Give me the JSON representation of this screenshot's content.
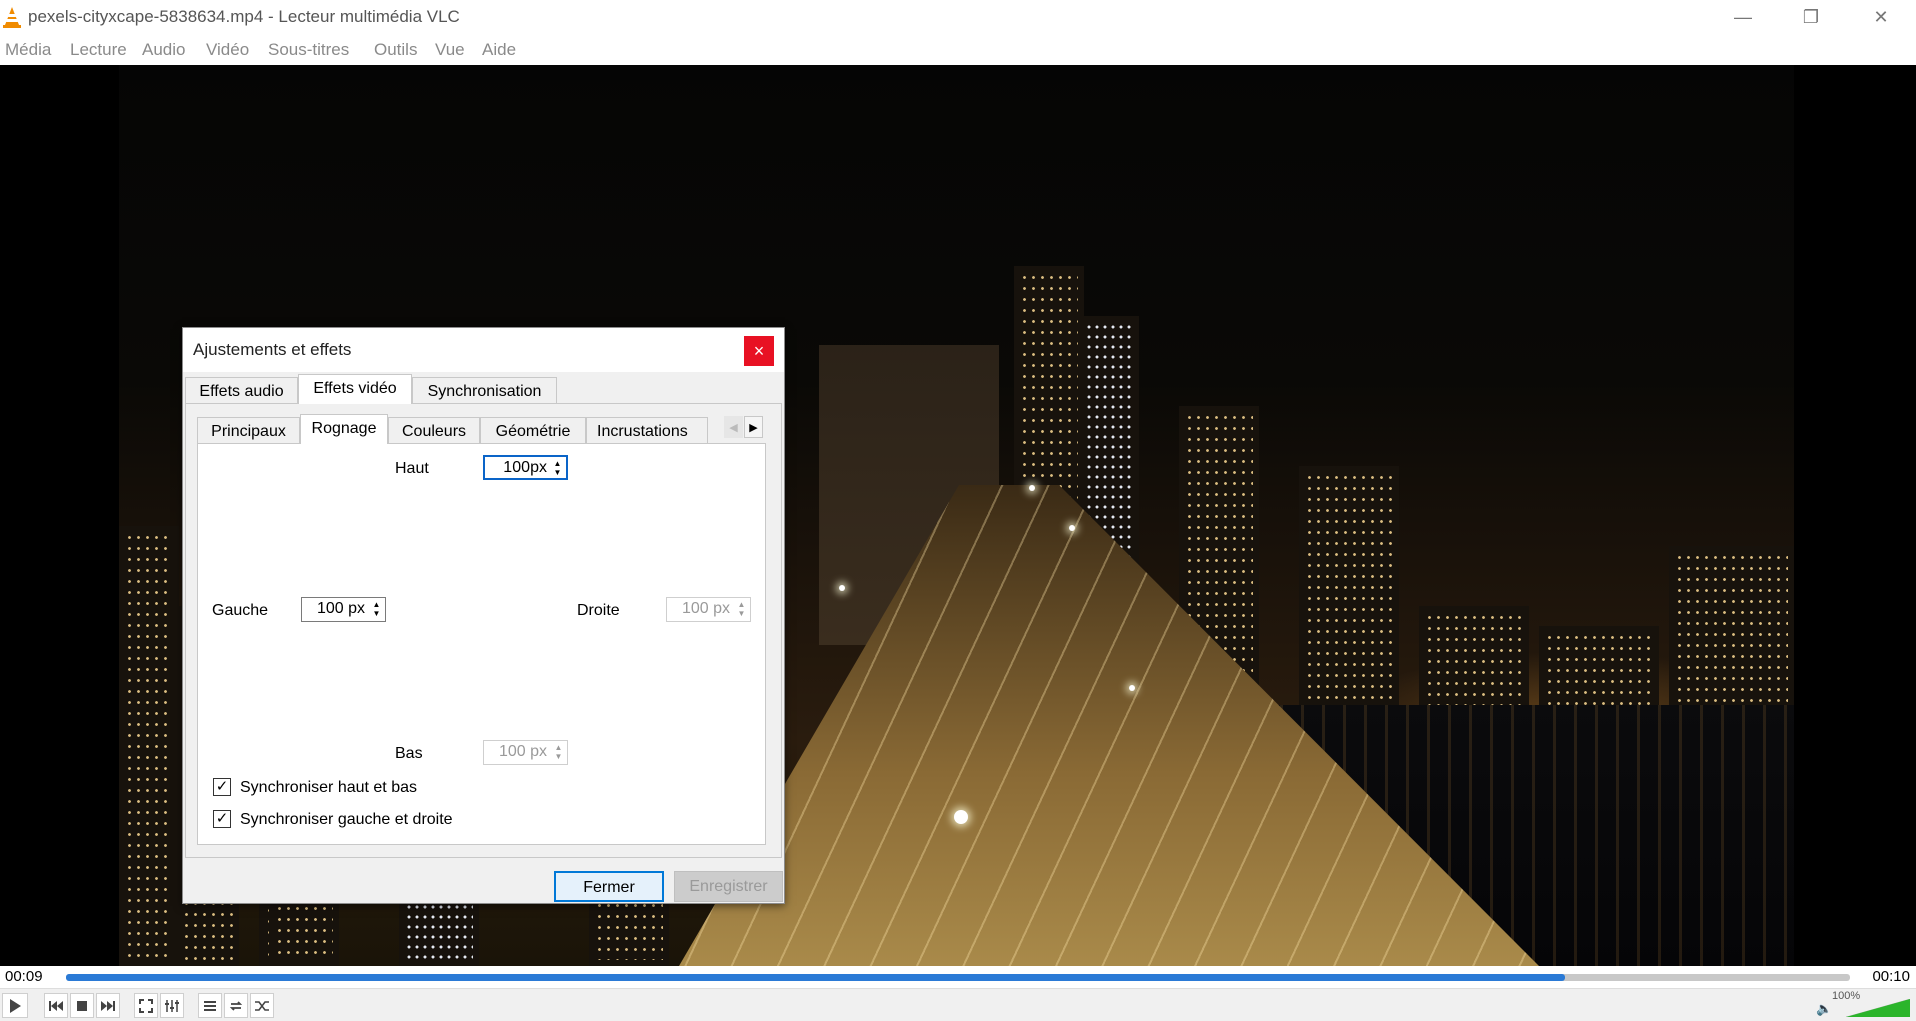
{
  "window": {
    "title": "pexels-cityxcape-5838634.mp4 - Lecteur multimédia VLC",
    "minimize": "—",
    "restore": "❐",
    "close": "✕"
  },
  "menu": [
    "Média",
    "Lecture",
    "Audio",
    "Vidéo",
    "Sous-titres",
    "Outils",
    "Vue",
    "Aide"
  ],
  "playback": {
    "time_elapsed": "00:09",
    "time_total": "00:10",
    "progress_fraction": 0.84,
    "volume_label": "100%"
  },
  "dialog": {
    "title": "Ajustements et effets",
    "close": "×",
    "main_tabs": [
      "Effets audio",
      "Effets vidéo",
      "Synchronisation"
    ],
    "active_main_tab": "Effets vidéo",
    "sub_tabs": [
      "Principaux",
      "Rognage",
      "Couleurs",
      "Géométrie",
      "Incrustations"
    ],
    "active_sub_tab": "Rognage",
    "crop": {
      "top_label": "Haut",
      "top_value": "100",
      "top_unit": "px",
      "left_label": "Gauche",
      "left_value": "100 px",
      "right_label": "Droite",
      "right_value": "100 px",
      "bottom_label": "Bas",
      "bottom_value": "100 px"
    },
    "sync_top_bottom": "Synchroniser haut et bas",
    "sync_left_right": "Synchroniser gauche et droite",
    "close_button": "Fermer",
    "save_button": "Enregistrer"
  },
  "icons": {
    "checkmark": "✓",
    "spin_up": "▲",
    "spin_down": "▼",
    "scroll_left": "◀",
    "scroll_right": "▶"
  },
  "colors": {
    "accent": "#2a7ad6",
    "close_red": "#e81123",
    "volume_green": "#2bb52b"
  }
}
